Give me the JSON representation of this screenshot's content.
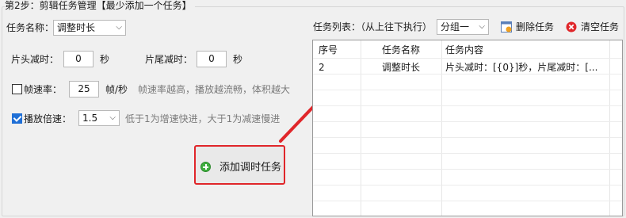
{
  "group": {
    "title": "第2步：剪辑任务管理【最少添加一个任务】"
  },
  "task_name": {
    "label": "任务名称：",
    "value": "调整时长"
  },
  "head_trim": {
    "label": "片头减时：",
    "value": "0",
    "unit": "秒"
  },
  "tail_trim": {
    "label": "片尾减时：",
    "value": "0",
    "unit": "秒"
  },
  "frame_rate": {
    "label": "帧速率：",
    "value": "25",
    "unit": "帧/秒",
    "hint": "帧速率越高，播放越流畅，体积越大",
    "checked": false
  },
  "speed": {
    "label": "播放倍速：",
    "value": "1.5",
    "hint": "低于1为增速快进，大于1为减速慢进",
    "checked": true
  },
  "add_button": {
    "label": "添加调时任务"
  },
  "task_list": {
    "label": "任务列表：（从上往下执行）",
    "group_select": "分组一",
    "delete_label": "删除任务",
    "clear_label": "清空任务",
    "columns": [
      "序号",
      "任务名称",
      "任务内容"
    ],
    "rows": [
      {
        "index": "2",
        "name": "调整时长",
        "content": "片头减时：[{0}]秒，片尾减时：[..."
      }
    ]
  },
  "colors": {
    "highlight": "#e0262a",
    "accent": "#1f6fd6"
  }
}
